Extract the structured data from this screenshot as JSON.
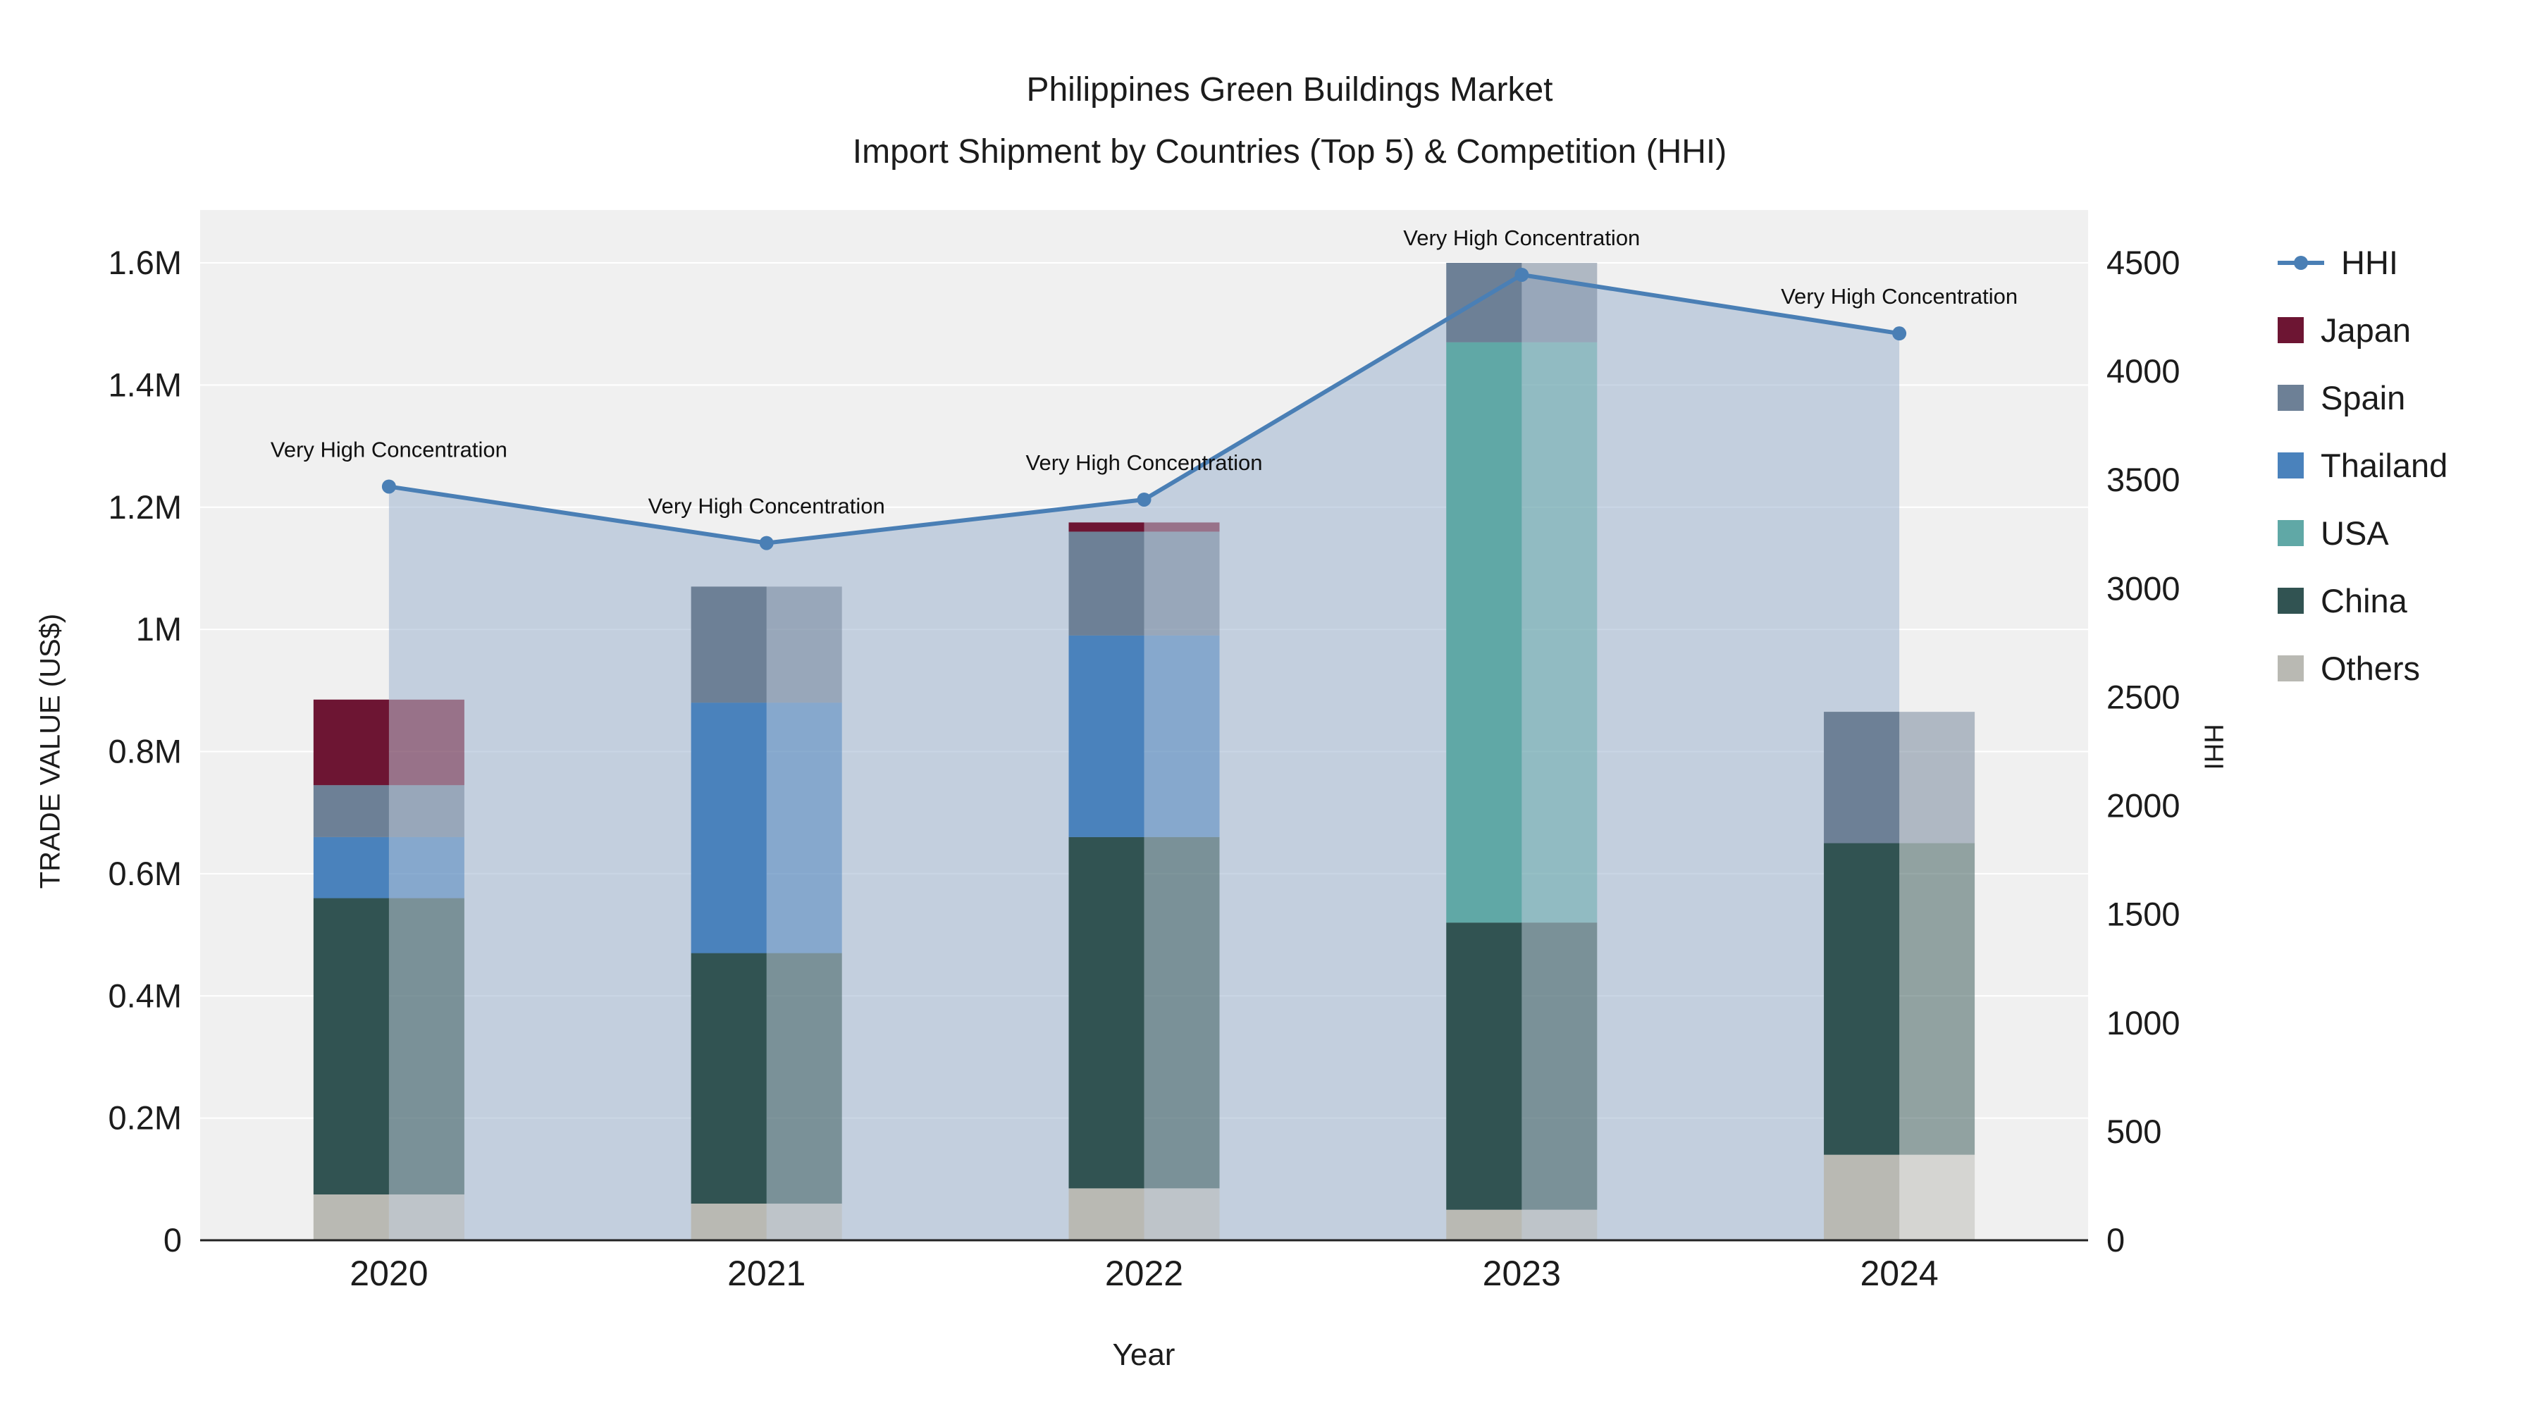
{
  "chart_data": {
    "type": "stacked_bar_with_line",
    "title": "Philippines Green Buildings Market",
    "subtitle": "Import Shipment by Countries (Top 5) & Competition (HHI)",
    "xlabel": "Year",
    "ylabel_left": "TRADE VALUE (US$)",
    "ylabel_right": "HHI",
    "categories": [
      "2020",
      "2021",
      "2022",
      "2023",
      "2024"
    ],
    "series": [
      {
        "name": "Others",
        "color": "#b9b9b3",
        "values": [
          75000,
          60000,
          85000,
          50000,
          140000
        ]
      },
      {
        "name": "China",
        "color": "#315352",
        "values": [
          485000,
          410000,
          575000,
          470000,
          510000
        ]
      },
      {
        "name": "USA",
        "color": "#60a8a6",
        "values": [
          0,
          0,
          0,
          950000,
          0
        ]
      },
      {
        "name": "Thailand",
        "color": "#4a82bc",
        "values": [
          100000,
          410000,
          330000,
          0,
          0
        ]
      },
      {
        "name": "Spain",
        "color": "#6d8096",
        "values": [
          85000,
          190000,
          170000,
          130000,
          215000
        ]
      },
      {
        "name": "Japan",
        "color": "#6d1533",
        "values": [
          140000,
          0,
          15000,
          0,
          0
        ]
      }
    ],
    "line": {
      "name": "HHI",
      "color": "#4a7fb5",
      "values": [
        3470,
        3210,
        3410,
        4445,
        4175
      ],
      "annotations": [
        "Very High Concentration",
        "Very High Concentration",
        "Very High Concentration",
        "Very High Concentration",
        "Very High Concentration"
      ]
    },
    "y_left_max": 1600000,
    "y_left_tick_labels": [
      "0",
      "0.2M",
      "0.4M",
      "0.6M",
      "0.8M",
      "1M",
      "1.2M",
      "1.4M",
      "1.6M"
    ],
    "y_right_max": 4500,
    "y_right_tick_labels": [
      "0",
      "500",
      "1000",
      "1500",
      "2000",
      "2500",
      "3000",
      "3500",
      "4000",
      "4500"
    ],
    "legend": [
      {
        "label": "HHI",
        "type": "line",
        "color": "#4a7fb5"
      },
      {
        "label": "Japan",
        "type": "square",
        "color": "#6d1533"
      },
      {
        "label": "Spain",
        "type": "square",
        "color": "#6d8096"
      },
      {
        "label": "Thailand",
        "type": "square",
        "color": "#4a82bc"
      },
      {
        "label": "USA",
        "type": "square",
        "color": "#60a8a6"
      },
      {
        "label": "China",
        "type": "square",
        "color": "#315352"
      },
      {
        "label": "Others",
        "type": "square",
        "color": "#b9b9b3"
      }
    ]
  },
  "colors": {
    "plot_bg": "#f0f0f0",
    "area_fill": "#96aecc",
    "grid": "#ffffff",
    "axis_line": "#222222",
    "text": "#1c1c1c"
  }
}
